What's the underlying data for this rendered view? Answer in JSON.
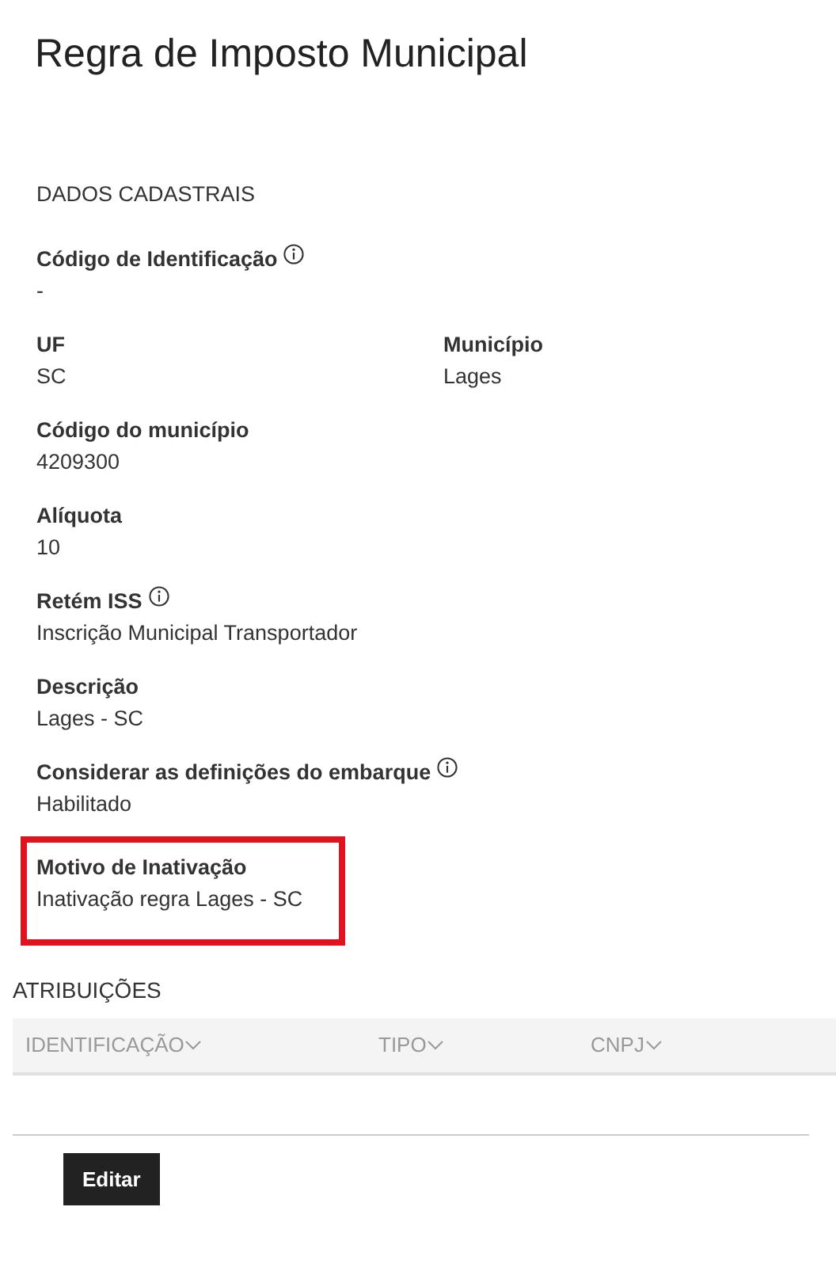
{
  "title": "Regra de Imposto Municipal",
  "section": "DADOS CADASTRAIS",
  "rows": [
    [
      {
        "label": "Código de Identificação",
        "value": "-",
        "info": true
      }
    ],
    [
      {
        "label": "UF",
        "value": "SC"
      },
      {
        "label": "Município",
        "value": "Lages"
      }
    ],
    [
      {
        "label": "Código do município",
        "value": "4209300"
      }
    ],
    [
      {
        "label": "Alíquota",
        "value": "10"
      }
    ],
    [
      {
        "label": "Retém ISS",
        "value": "Inscrição Municipal Transportador",
        "info": true
      }
    ],
    [
      {
        "label": "Descrição",
        "value": "Lages - SC"
      }
    ],
    [
      {
        "label": "Considerar as definições do embarque",
        "value": "Habilitado",
        "info": true
      }
    ],
    [
      {
        "label": "Motivo de Inativação",
        "value": "Inativação regra Lages - SC",
        "highlighted": true
      }
    ]
  ],
  "assignments": {
    "title": "ATRIBUIÇÕES",
    "columns": [
      "IDENTIFICAÇÃO",
      "TIPO",
      "CNPJ"
    ]
  },
  "buttons": [
    "Editar"
  ]
}
